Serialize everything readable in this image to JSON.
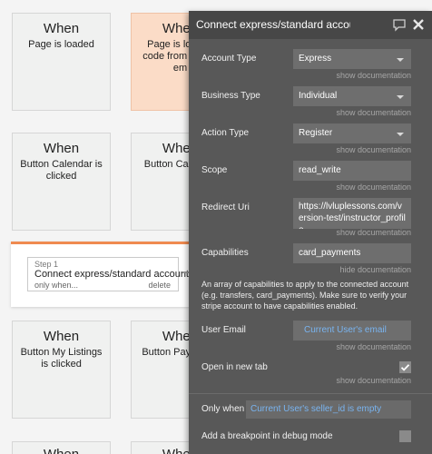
{
  "canvas": {
    "cards": [
      {
        "when": "When",
        "condition": "Page is loaded"
      },
      {
        "when": "When",
        "condition": "Page is loaded code from pa not em"
      },
      {
        "when": "When",
        "condition": "Button Calendar is clicked"
      },
      {
        "when": "When",
        "condition": "Button Ca clicke"
      },
      {
        "when": "When",
        "condition": "Button My Listings is clicked"
      },
      {
        "when": "When",
        "condition": "Button Pay clicke"
      },
      {
        "when": "When",
        "condition": ""
      },
      {
        "when": "When",
        "condition": ""
      }
    ],
    "right_edge": {
      "top": "When",
      "mid": "n",
      "low": "e"
    },
    "step": {
      "number": "Step 1",
      "title": "Connect express/standard account",
      "only_when": "only when...",
      "delete": "delete"
    }
  },
  "panel": {
    "title": "Connect express/standard account",
    "icons": {
      "comment": "comment-icon",
      "close": "close-icon"
    },
    "doc_show": "show documentation",
    "doc_hide": "hide documentation",
    "rows": {
      "account_type": {
        "label": "Account Type",
        "value": "Express"
      },
      "business_type": {
        "label": "Business Type",
        "value": "Individual"
      },
      "action_type": {
        "label": "Action Type",
        "value": "Register"
      },
      "scope": {
        "label": "Scope",
        "value": "read_write"
      },
      "redirect_uri": {
        "label": "Redirect Uri",
        "value": "https://lvluplessons.com/version-test/instructor_profile"
      },
      "capabilities": {
        "label": "Capabilities",
        "value": "card_payments"
      },
      "user_email": {
        "label": "User Email",
        "value": "Current User's email"
      },
      "open_new_tab": {
        "label": "Open in new tab",
        "checked": true
      },
      "only_when": {
        "label": "Only when",
        "value": "Current User's seller_id is empty"
      },
      "breakpoint": {
        "label": "Add a breakpoint in debug mode",
        "checked": false
      }
    },
    "capabilities_description": "An array of capabilities to apply to the connected account (e.g. transfers, card_payments). Make sure to verify your stripe account to have capabilities enabled.",
    "colors": {
      "panel_bg": "#585858",
      "header_bg": "#474747",
      "field_bg": "#6e6e6e",
      "dynamic_text": "#79b4f0",
      "accent": "#ef8a50"
    }
  }
}
